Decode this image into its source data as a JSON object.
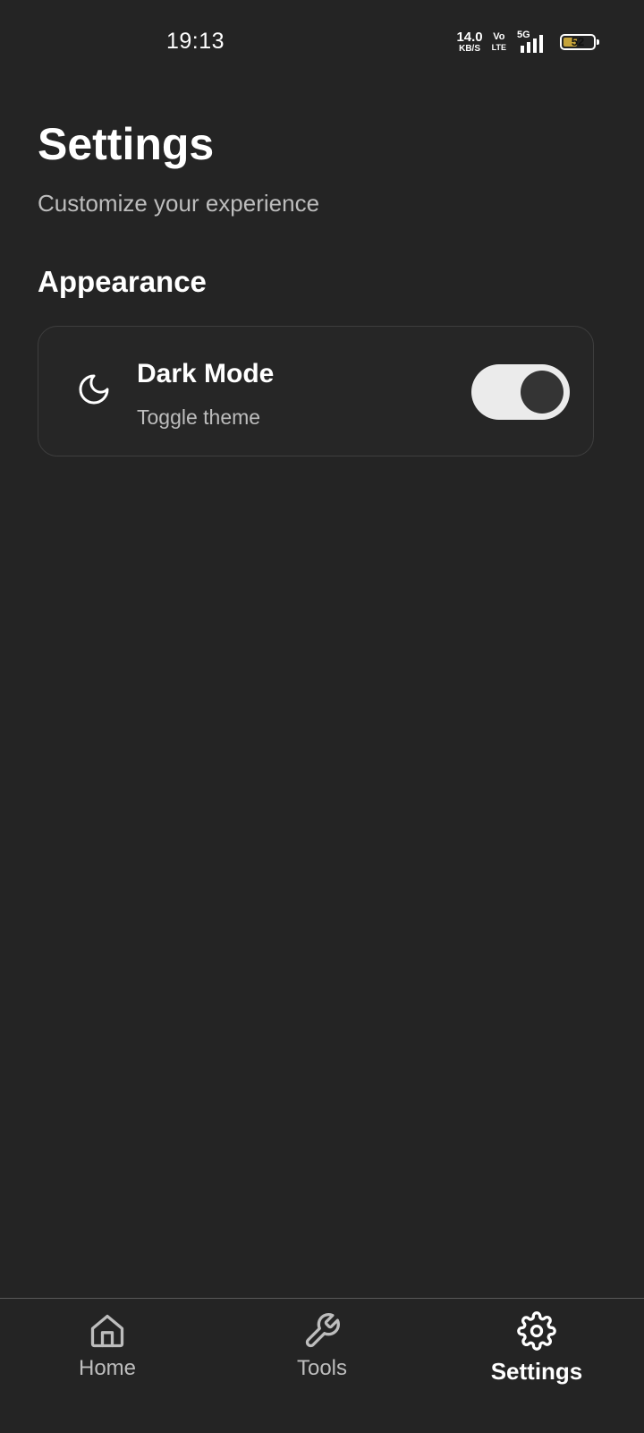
{
  "status_bar": {
    "time": "19:13",
    "net_speed_value": "14.0",
    "net_speed_unit": "KB/S",
    "volte_top": "Vo",
    "volte_bottom": "LTE",
    "network_type": "5G",
    "battery_level": "52",
    "battery_color": "#c5a33a"
  },
  "header": {
    "title": "Settings",
    "subtitle": "Customize your experience"
  },
  "sections": [
    {
      "title": "Appearance",
      "items": [
        {
          "icon": "moon-icon",
          "label": "Dark Mode",
          "description": "Toggle theme",
          "toggle_on": true
        }
      ]
    }
  ],
  "bottom_nav": {
    "items": [
      {
        "icon": "home-icon",
        "label": "Home",
        "active": false
      },
      {
        "icon": "wrench-icon",
        "label": "Tools",
        "active": false
      },
      {
        "icon": "gear-icon",
        "label": "Settings",
        "active": true
      }
    ]
  },
  "colors": {
    "background": "#242424",
    "card_border": "#3e3e3e",
    "toggle_track": "#ebebeb",
    "toggle_knob": "#343434",
    "secondary_text": "#bdbdbd"
  }
}
